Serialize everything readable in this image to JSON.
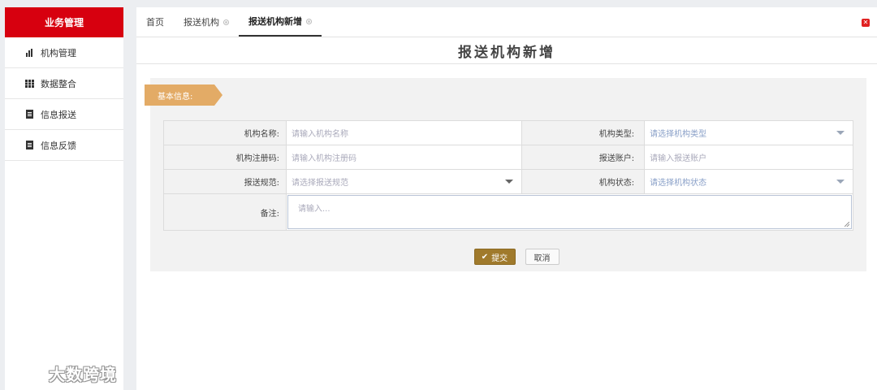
{
  "sidebar": {
    "header": "业务管理",
    "items": [
      {
        "label": "机构管理",
        "icon": "bar-chart-icon"
      },
      {
        "label": "数据整合",
        "icon": "grid-icon"
      },
      {
        "label": "信息报送",
        "icon": "document-icon"
      },
      {
        "label": "信息反馈",
        "icon": "document-icon"
      }
    ]
  },
  "watermark": {
    "text": "大数跨境"
  },
  "tabs": [
    {
      "label": "首页"
    },
    {
      "label": "报送机构"
    },
    {
      "label": "报送机构新增"
    }
  ],
  "page_title": "报送机构新增",
  "section": {
    "label": "基本信息:"
  },
  "form": {
    "org_name": {
      "label": "机构名称:",
      "placeholder": "请输入机构名称"
    },
    "org_type": {
      "label": "机构类型:",
      "placeholder": "请选择机构类型"
    },
    "reg_code": {
      "label": "机构注册码:",
      "placeholder": "请输入机构注册码"
    },
    "account": {
      "label": "报送账户:",
      "placeholder": "请输入报送账户"
    },
    "spec": {
      "label": "报送规范:",
      "placeholder": "请选择报送规范"
    },
    "status": {
      "label": "机构状态:",
      "placeholder": "请选择机构状态"
    },
    "notes": {
      "label": "备注:",
      "placeholder": "请输入..."
    }
  },
  "buttons": {
    "submit": "提交",
    "cancel": "取消"
  },
  "colors": {
    "brand_red": "#d7000f",
    "section_tag": "#e3ab66",
    "submit": "#a07a2c"
  }
}
